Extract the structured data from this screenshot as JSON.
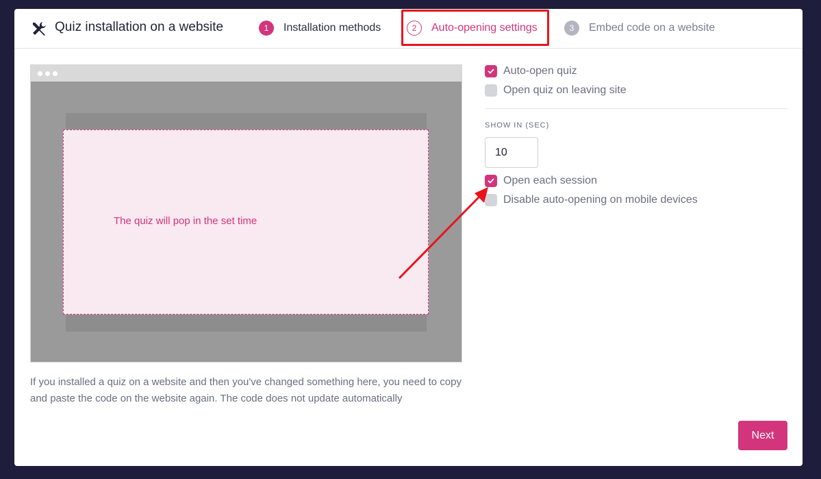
{
  "header": {
    "title": "Quiz installation on a website",
    "title_icon": "tools-icon",
    "steps": [
      {
        "number": "1",
        "label": "Installation methods",
        "state": "done"
      },
      {
        "number": "2",
        "label": "Auto-opening settings",
        "state": "active"
      },
      {
        "number": "3",
        "label": "Embed code on a website",
        "state": "pending"
      }
    ]
  },
  "preview": {
    "popup_text": "The quiz will pop in the set time",
    "note": "If you installed a quiz on a website and then you've changed something here, you need to copy and paste the code on the website again. The code does not update automatically"
  },
  "settings": {
    "auto_open": {
      "label": "Auto-open quiz",
      "checked": true
    },
    "open_on_leave": {
      "label": "Open quiz on leaving site",
      "checked": false
    },
    "show_in_label": "SHOW IN (SEC)",
    "show_in_value": "10",
    "open_each_session": {
      "label": "Open each session",
      "checked": true
    },
    "disable_mobile": {
      "label": "Disable auto-opening on mobile devices",
      "checked": false
    }
  },
  "footer": {
    "next_label": "Next"
  },
  "colors": {
    "accent": "#d2357c",
    "annotation": "#e8141c",
    "background": "#1e1d3b"
  }
}
